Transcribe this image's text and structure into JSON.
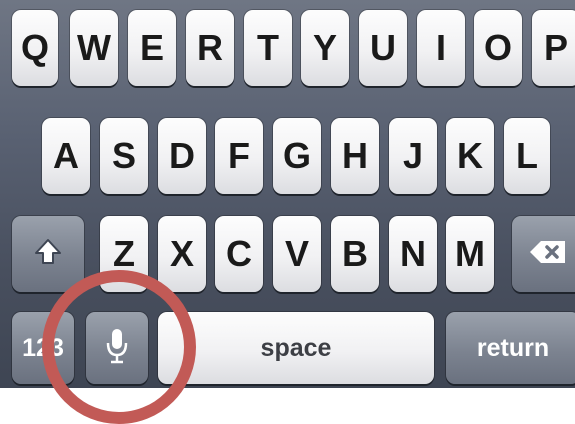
{
  "keyboard": {
    "row1": [
      "Q",
      "W",
      "E",
      "R",
      "T",
      "Y",
      "U",
      "I",
      "O",
      "P"
    ],
    "row2": [
      "A",
      "S",
      "D",
      "F",
      "G",
      "H",
      "J",
      "K",
      "L"
    ],
    "row3": [
      "Z",
      "X",
      "C",
      "V",
      "B",
      "N",
      "M"
    ],
    "numbers_label": "123",
    "space_label": "space",
    "return_label": "return",
    "shift_icon": "shift-arrow-icon",
    "delete_icon": "backspace-icon",
    "mic_icon": "microphone-icon"
  },
  "colors": {
    "keyboard_bg": "#5a6272",
    "key_light": "#f4f4f6",
    "key_dark": "#7c8390",
    "highlight_circle": "#c25a56"
  }
}
